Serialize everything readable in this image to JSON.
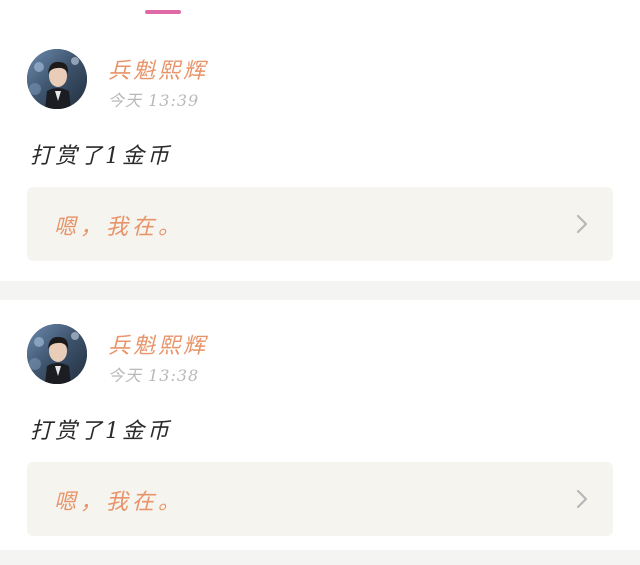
{
  "colors": {
    "accent": "#e06aa8",
    "username": "#e8946a",
    "timestamp": "#b9b9b9",
    "quote_bg": "#f5f4ef",
    "divider": "#f4f4f2"
  },
  "feed": {
    "items": [
      {
        "username": "兵魁熙辉",
        "time": "今天 13:39",
        "action": "打赏了1金币",
        "quote": "嗯，我在。",
        "chevron_icon": "chevron-right-icon"
      },
      {
        "username": "兵魁熙辉",
        "time": "今天 13:38",
        "action": "打赏了1金币",
        "quote": "嗯，我在。",
        "chevron_icon": "chevron-right-icon"
      }
    ]
  }
}
